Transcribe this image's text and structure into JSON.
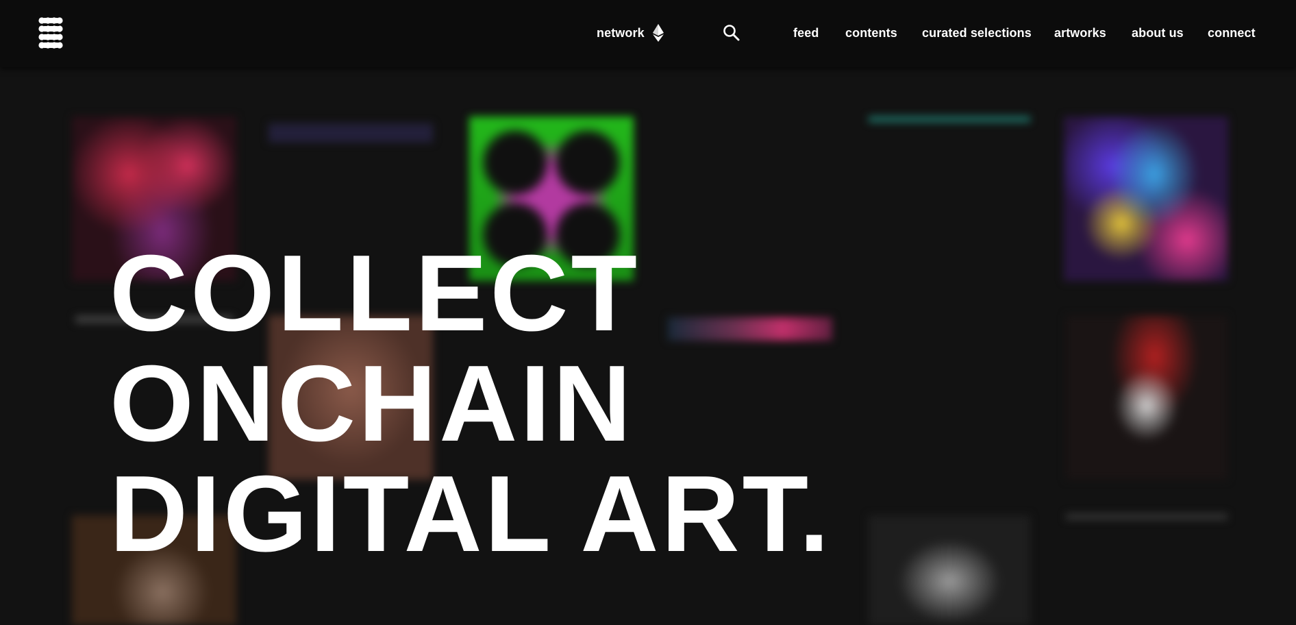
{
  "nav": {
    "logo_icon": "grid-dots-logo-icon",
    "network_label": "network",
    "network_icon": "ethereum-icon",
    "search_icon": "search-icon",
    "links": [
      "feed",
      "contents",
      "curated selections",
      "artworks",
      "about us",
      "connect"
    ]
  },
  "hero": {
    "line1": "COLLECT",
    "line2": "ONCHAIN",
    "line3": "DIGITAL ART."
  },
  "colors": {
    "background": "#121212",
    "navbar": "#0c0c0c",
    "text": "#ffffff"
  }
}
